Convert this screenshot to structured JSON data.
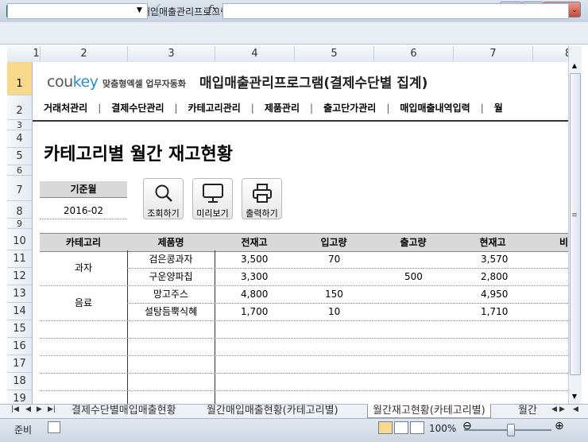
{
  "window": {
    "title": "Microsoft Excel - (5414) 매입매출관리프로그램(결제수단별 집계)",
    "app_icon": "X"
  },
  "formula_bar": {
    "name_box": "",
    "fx": "fx",
    "formula": ""
  },
  "columns": [
    "1",
    "2",
    "3",
    "4",
    "5",
    "6",
    "7",
    "8"
  ],
  "rows": [
    "1",
    "2",
    "3",
    "4",
    "5",
    "6",
    "7",
    "8",
    "9",
    "10",
    "11",
    "12",
    "13",
    "14",
    "15",
    "16",
    "17",
    "18",
    "19"
  ],
  "brand": {
    "logo_a": "cou",
    "logo_b": "key",
    "tagline": "맞춤형엑셀 업무자동화",
    "app_title": "매입매출관리프로그램(결제수단별 집계)"
  },
  "nav": [
    "거래처관리",
    "결제수단관리",
    "카테고리관리",
    "제품관리",
    "출고단가관리",
    "매입매출내역입력",
    "월"
  ],
  "nav_separator": "|",
  "page_heading": "카테고리별 월간 재고현황",
  "period": {
    "label": "기준월",
    "value": "2016-02"
  },
  "actions": [
    {
      "label": "조회하기",
      "icon": "search-icon"
    },
    {
      "label": "미리보기",
      "icon": "monitor-icon"
    },
    {
      "label": "출력하기",
      "icon": "printer-icon"
    }
  ],
  "table": {
    "headers": [
      "카테고리",
      "제품명",
      "전재고",
      "입고량",
      "출고량",
      "현재고",
      "비"
    ],
    "groups": [
      {
        "category": "과자",
        "rows": [
          {
            "product": "검은콩과자",
            "prev": "3,500",
            "in": "70",
            "out": "",
            "current": "3,570"
          },
          {
            "product": "구운양파칩",
            "prev": "3,300",
            "in": "",
            "out": "500",
            "current": "2,800"
          }
        ]
      },
      {
        "category": "음료",
        "rows": [
          {
            "product": "망고주스",
            "prev": "4,800",
            "in": "150",
            "out": "",
            "current": "4,950"
          },
          {
            "product": "설탕듬뿍식혜",
            "prev": "1,700",
            "in": "10",
            "out": "",
            "current": "1,710"
          }
        ]
      }
    ]
  },
  "sheet_tabs": [
    {
      "label": "결제수단별매입매출현황",
      "active": false
    },
    {
      "label": "월간매입매출현황(카테고리별)",
      "active": false
    },
    {
      "label": "월간재고현황(카테고리별)",
      "active": true
    },
    {
      "label": "월간",
      "active": false
    }
  ],
  "status": {
    "mode": "준비",
    "zoom": "100%"
  },
  "colors": {
    "accent": "#2b8fd0",
    "header_fill": "#d9d9d9",
    "active_row": "#f9d98b"
  }
}
